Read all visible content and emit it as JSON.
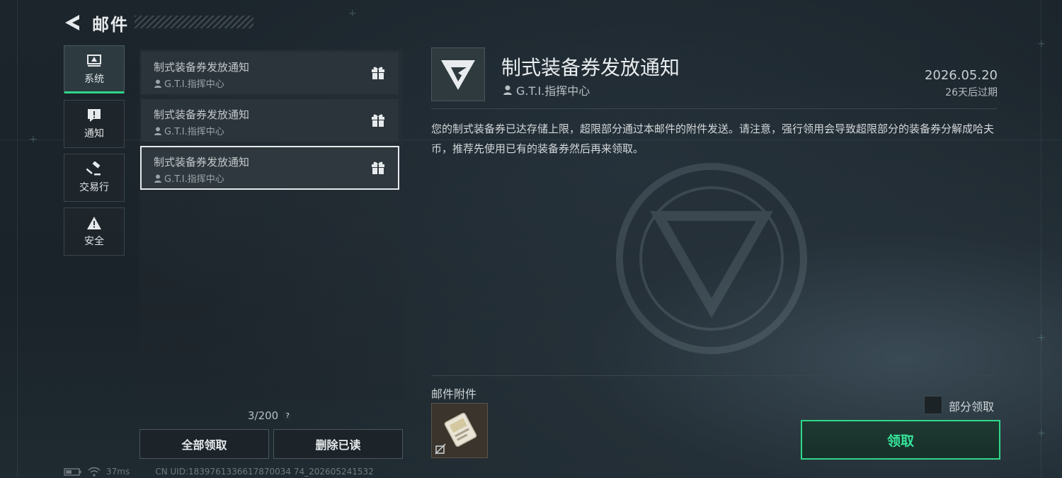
{
  "header": {
    "title": "邮件"
  },
  "categories": [
    {
      "label": "系统",
      "icon": "system-icon",
      "active": true
    },
    {
      "label": "通知",
      "icon": "notice-icon",
      "active": false
    },
    {
      "label": "交易行",
      "icon": "auction-icon",
      "active": false
    },
    {
      "label": "安全",
      "icon": "warning-icon",
      "active": false
    }
  ],
  "mails": [
    {
      "subject": "制式装备券发放通知",
      "sender": "G.T.I.指挥中心",
      "icon": "gift-icon"
    },
    {
      "subject": "制式装备券发放通知",
      "sender": "G.T.I.指挥中心",
      "icon": "gift-icon"
    },
    {
      "subject": "制式装备券发放通知",
      "sender": "G.T.I.指挥中心",
      "icon": "gift-icon",
      "selected": true
    }
  ],
  "list_footer": {
    "count": "3/200",
    "help": "?",
    "claim_all": "全部领取",
    "delete_read": "删除已读"
  },
  "status": {
    "ping": "37ms",
    "uid": "CN UID:1839761336617870034 74_202605241532"
  },
  "detail": {
    "title": "制式装备券发放通知",
    "sender": "G.T.I.指挥中心",
    "date": "2026.05.20",
    "expire": "26天后过期",
    "body": "您的制式装备券已达存储上限，超限部分通过本邮件的附件发送。请注意，强行领用会导致超限部分的装备券分解成哈夫币，推荐先使用已有的装备券然后再来领取。",
    "attachments_label": "邮件附件",
    "partial_claim": "部分领取",
    "claim": "领取"
  },
  "colors": {
    "accent": "#2ed68a",
    "text": "#e6eaec"
  }
}
